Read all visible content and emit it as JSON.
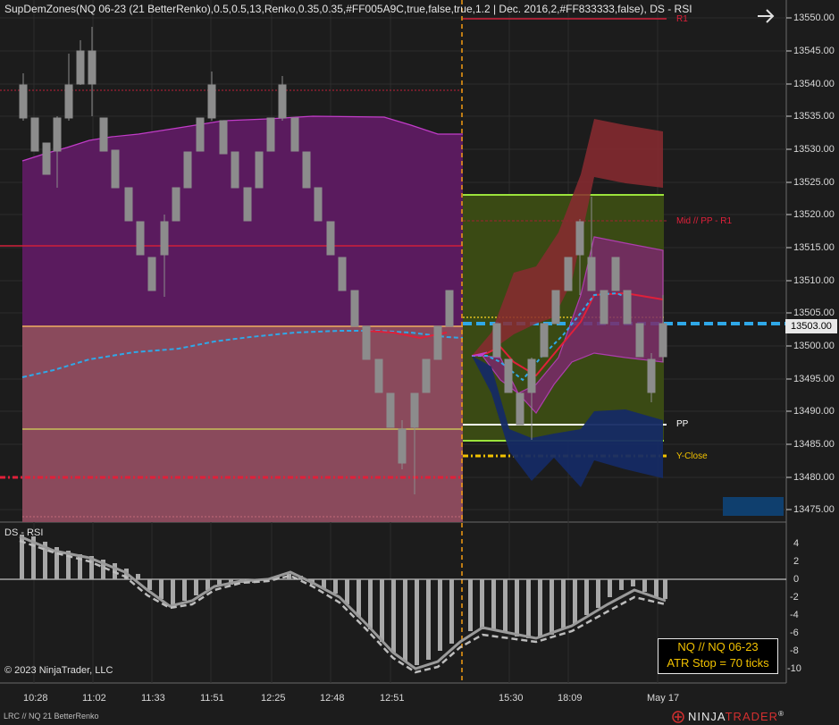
{
  "chart": {
    "title": "SupDemZones(NQ 06-23 (21 BetterRenko),0.5,0.5,13,Renko,0.35,0.35,#FF005A9C,true,false,true,1.2 | Dec. 2016,2,#FF833333,false), DS - RSI",
    "current_price": "13503.00",
    "rsi_panel_label": "DS - RSI",
    "copyright": "© 2023 NinjaTrader, LLC",
    "status_bar": "LRC // NQ  21 BetterRenko",
    "brand_name": "NINJA",
    "brand_accent": "TRADER",
    "brand_mark": "®",
    "info_box": {
      "line1": "NQ // NQ 06-23",
      "line2": "ATR Stop = 70 ticks"
    },
    "level_labels": {
      "r1": "R1",
      "mid_pp_r1": "Mid // PP - R1",
      "pp": "PP",
      "y_close": "Y-Close"
    },
    "price_axis_labels": [
      "13550.00",
      "13545.00",
      "13540.00",
      "13535.00",
      "13530.00",
      "13525.00",
      "13520.00",
      "13515.00",
      "13510.00",
      "13505.00",
      "13500.00",
      "13495.00",
      "13490.00",
      "13485.00",
      "13480.00",
      "13475.00"
    ],
    "rsi_axis_labels": [
      "4",
      "2",
      "0",
      "-2",
      "-4",
      "-6",
      "-8",
      "-10"
    ],
    "time_axis_labels": [
      "10:28",
      "11:02",
      "11:33",
      "11:51",
      "12:25",
      "12:48",
      "12:51",
      "15:30",
      "18:09",
      "May 17"
    ],
    "colors": {
      "background": "#1c1c1c",
      "supply_zone": "#5a1b5e",
      "demand_zone": "#8a4a5c",
      "resistance_line": "#d0203a",
      "pivot_green": "#9be33b",
      "pivot_zone": "#3a4a14",
      "renko_bar": "#8c8c8c",
      "separator": "#f39c12",
      "info_text": "#f2c200"
    },
    "icons": {
      "nav": "arrow-right-icon",
      "brand": "ninjatrader-logo-icon"
    }
  }
}
